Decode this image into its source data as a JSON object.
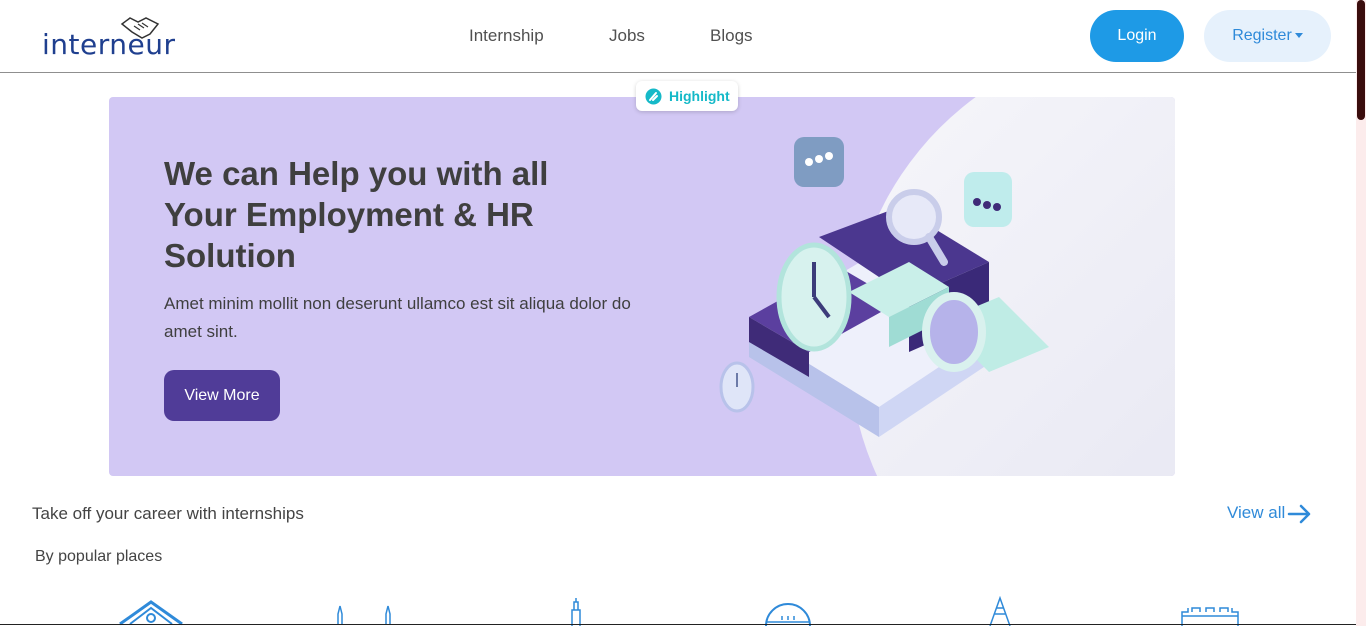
{
  "header": {
    "logo": "interneur",
    "nav": [
      "Internship",
      "Jobs",
      "Blogs"
    ],
    "login": "Login",
    "register": "Register"
  },
  "badge": {
    "label": "Highlight"
  },
  "hero": {
    "title": "We can Help you with all Your Employment & HR Solution",
    "subtitle": "Amet minim mollit non deserunt ullamco est sit aliqua dolor do amet sint.",
    "button": "View More"
  },
  "section": {
    "title": "Take off your career with internships",
    "view_all": "View all",
    "popular": "By popular places"
  },
  "colors": {
    "accent": "#1e9ae6",
    "hero_bg": "#d2c8f4",
    "hero_button": "#503c98",
    "highlight": "#15b9c8"
  },
  "icons": [
    "handshake-icon",
    "highlight-icon",
    "arrow-right-icon",
    "place-landmark-icon"
  ]
}
